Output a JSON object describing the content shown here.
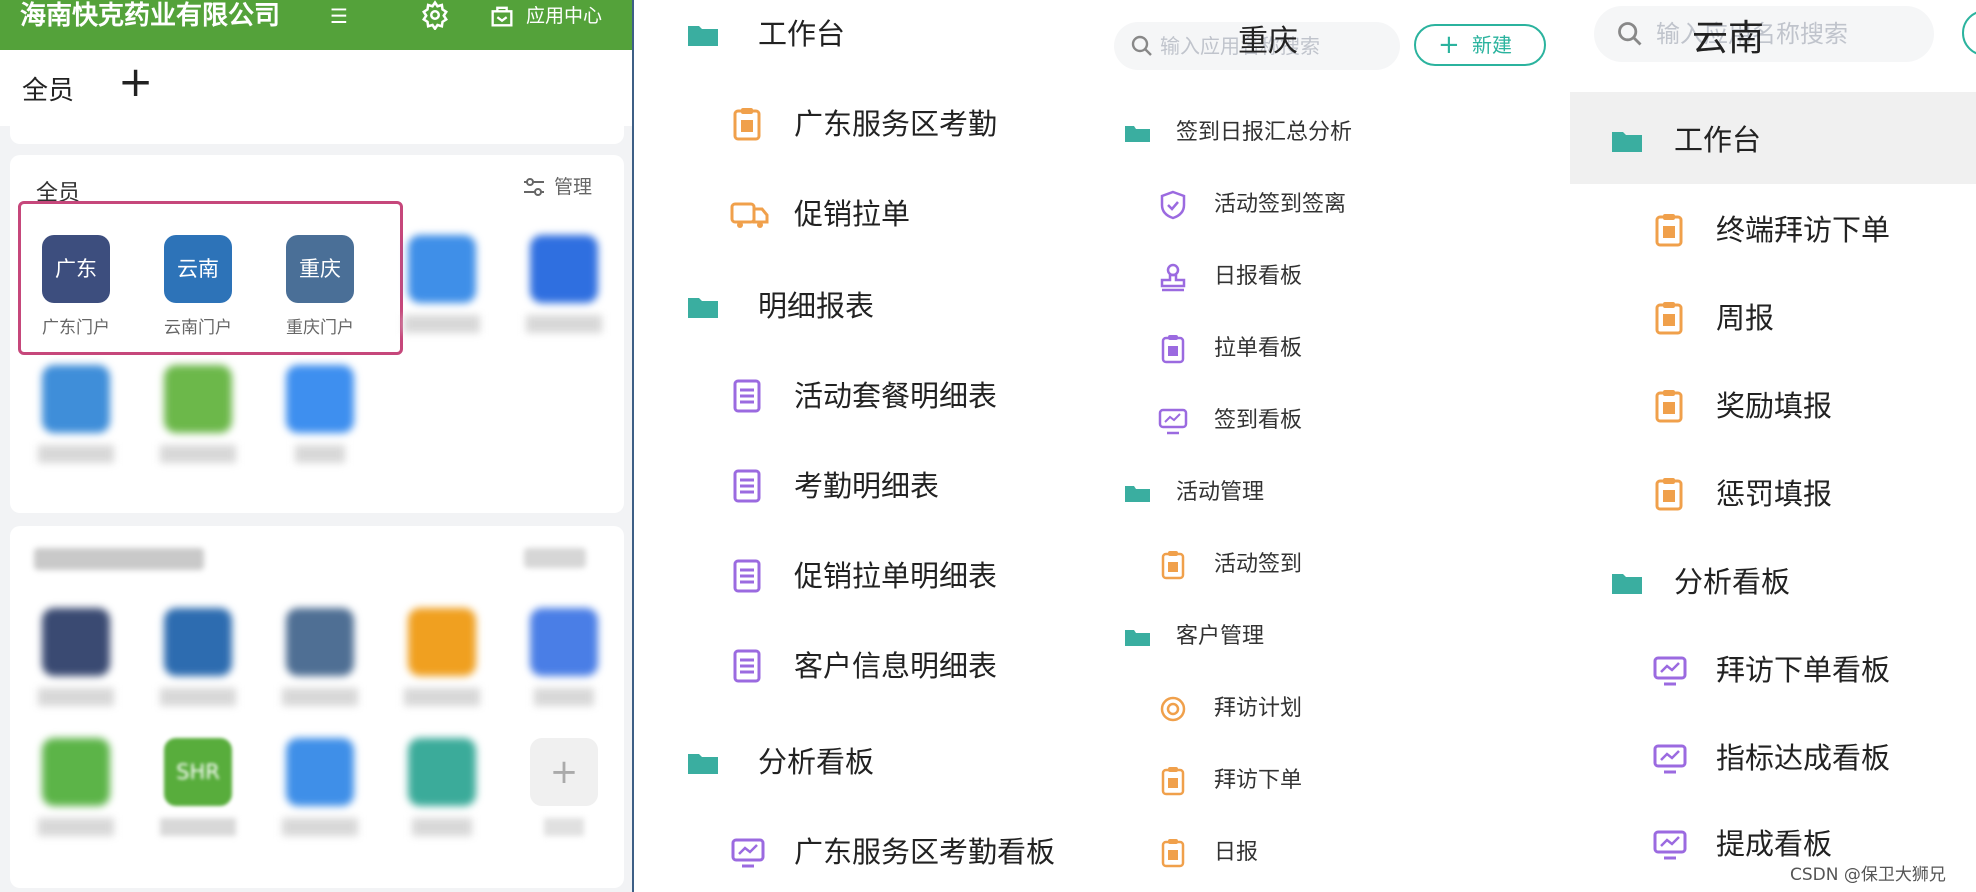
{
  "colors": {
    "topbar_green": "#54a23a",
    "highlight_box": "#c6477b",
    "folder_teal": "#3aaea0",
    "icon_orange": "#f0a04b",
    "icon_purple": "#9b6ae0",
    "new_button_teal": "#2bb39e"
  },
  "left_panel": {
    "company_name": "海南快克药业有限公司",
    "menu_icon_glyph": "☰",
    "app_center_label": "应用中心",
    "tabs": [
      {
        "label": "全员",
        "active": true
      },
      {
        "label": "+"
      }
    ],
    "section_title": "全员",
    "manage_label": "管理",
    "portal_apps": [
      {
        "tile": "广东",
        "label": "广东门户",
        "color": "#3d4e7e"
      },
      {
        "tile": "云南",
        "label": "云南门户",
        "color": "#2d73b8"
      },
      {
        "tile": "重庆",
        "label": "重庆门户",
        "color": "#4a6f97"
      }
    ],
    "add_tile_glyph": "+",
    "shr_tile_text": "SHR"
  },
  "middle_panel": {
    "sections": [
      {
        "title": "工作台",
        "items": [
          "广东服务区考勤",
          "促销拉单"
        ]
      },
      {
        "title": "明细报表",
        "items": [
          "活动套餐明细表",
          "考勤明细表",
          "促销拉单明细表",
          "客户信息明细表"
        ]
      },
      {
        "title": "分析看板",
        "items": [
          "广东服务区考勤看板"
        ]
      }
    ]
  },
  "chongqing_panel": {
    "search_placeholder": "输入应用名称搜索",
    "city": "重庆",
    "new_button": {
      "plus": "+",
      "label": "新建"
    },
    "sections": [
      {
        "title": "签到日报汇总分析",
        "items": [
          "活动签到签离",
          "日报看板",
          "拉单看板",
          "签到看板"
        ]
      },
      {
        "title": "活动管理",
        "items": [
          "活动签到"
        ]
      },
      {
        "title": "客户管理",
        "items": [
          "拜访计划",
          "拜访下单",
          "日报"
        ]
      }
    ]
  },
  "yunnan_panel": {
    "search_placeholder": "输入应用名称搜索",
    "city": "云南",
    "sections": [
      {
        "title": "工作台",
        "items": [
          "终端拜访下单",
          "周报",
          "奖励填报",
          "惩罚填报"
        ]
      },
      {
        "title": "分析看板",
        "items": [
          "拜访下单看板",
          "指标达成看板",
          "提成看板"
        ]
      }
    ]
  },
  "watermark": "CSDN @保卫大狮兄"
}
